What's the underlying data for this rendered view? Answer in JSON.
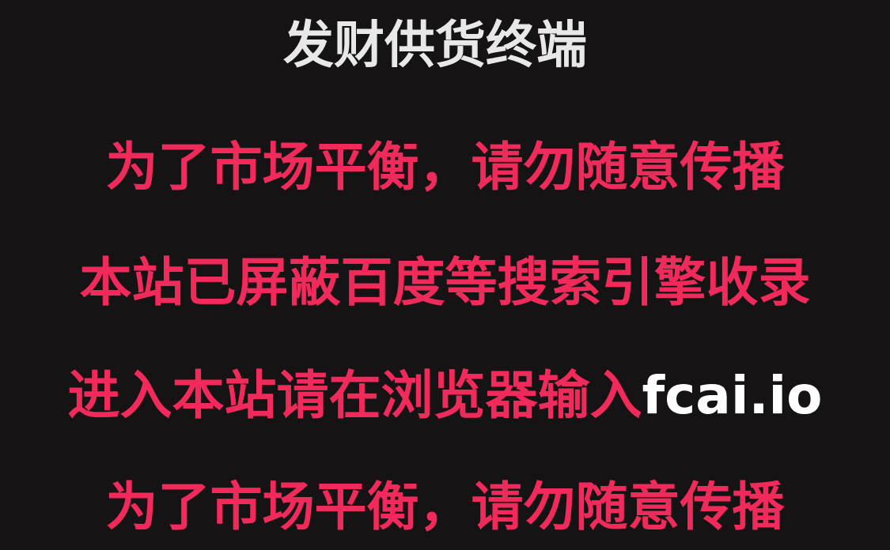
{
  "colors": {
    "background": "#151314",
    "title": "#e8e8e8",
    "accent": "#f02a5a",
    "domain": "#ffffff"
  },
  "title": "发财供货终端",
  "lines": {
    "line1": "为了市场平衡，请勿随意传播",
    "line2": "本站已屏蔽百度等搜索引擎收录",
    "line3_prefix": "进入本站请在浏览器输入",
    "line3_domain": "fcai.io",
    "line4": "为了市场平衡，请勿随意传播"
  }
}
